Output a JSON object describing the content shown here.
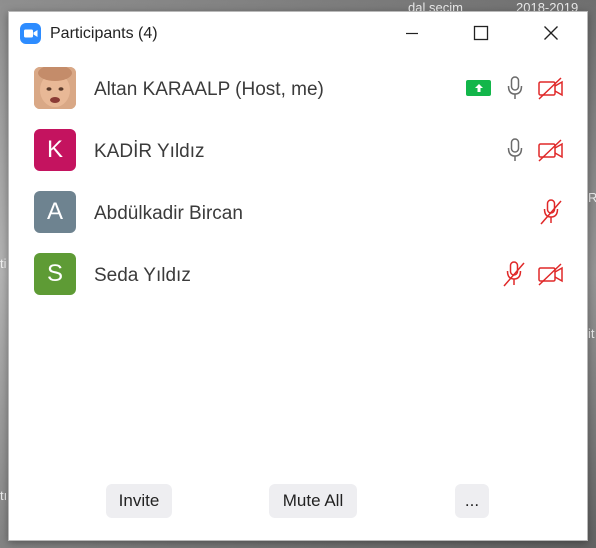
{
  "desktop": {
    "fragments": [
      "dal seçim",
      "2018-2019",
      "R",
      "it",
      "ti",
      "tı"
    ]
  },
  "window": {
    "title": "Participants (4)",
    "app_icon": "zoom-camera-icon",
    "controls": [
      "minimize-icon",
      "maximize-icon",
      "close-icon"
    ]
  },
  "participants": [
    {
      "name": "Altan KARAALP (Host, me)",
      "avatar_type": "photo",
      "sharing": true,
      "mic": "on",
      "video": "off"
    },
    {
      "name": "KADİR Yıldız",
      "avatar_letter": "K",
      "avatar_color": "#c4135f",
      "mic": "on",
      "video": "off"
    },
    {
      "name": "Abdülkadir Bircan",
      "avatar_letter": "A",
      "avatar_color": "#6e8390",
      "mic": "off",
      "video": "none"
    },
    {
      "name": "Seda Yıldız",
      "avatar_letter": "S",
      "avatar_color": "#5e9b35",
      "mic": "off",
      "video": "off"
    }
  ],
  "colors": {
    "muted_red": "#e02828",
    "mic_gray": "#6b6b6b",
    "share_green": "#12b64a",
    "brand_blue": "#2d8cff"
  },
  "footer": {
    "invite_label": "Invite",
    "mute_all_label": "Mute All",
    "more_label": "..."
  }
}
